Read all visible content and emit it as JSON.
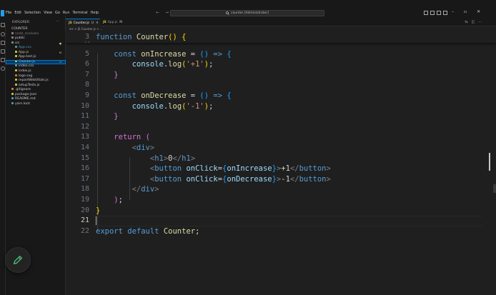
{
  "menu": [
    "File",
    "Edit",
    "Selection",
    "View",
    "Go",
    "Run",
    "Terminal",
    "Help"
  ],
  "search": {
    "text": "counter [Administrator]"
  },
  "explorer": {
    "header": "EXPLORER",
    "items": [
      {
        "label": "COUNTER",
        "depth": 0,
        "kind": "root"
      },
      {
        "label": "node_modules",
        "depth": 1,
        "kind": "folder",
        "color": "#7d7d7d"
      },
      {
        "label": "public",
        "depth": 1,
        "kind": "folder",
        "color": "#cccccc"
      },
      {
        "label": "src",
        "depth": 1,
        "kind": "folder",
        "color": "#cccccc",
        "badge": "●"
      },
      {
        "label": "App.css",
        "depth": 2,
        "kind": "css",
        "color": "#519aba"
      },
      {
        "label": "App.js",
        "depth": 2,
        "kind": "js",
        "color": "#e2c08d",
        "badge": "M"
      },
      {
        "label": "App.test.js",
        "depth": 2,
        "kind": "js",
        "color": "#cccccc"
      },
      {
        "label": "Counter.js",
        "depth": 2,
        "kind": "js",
        "color": "#cccccc",
        "badge": "U",
        "selected": true
      },
      {
        "label": "index.css",
        "depth": 2,
        "kind": "css",
        "color": "#cccccc"
      },
      {
        "label": "index.js",
        "depth": 2,
        "kind": "js",
        "color": "#cccccc"
      },
      {
        "label": "logo.svg",
        "depth": 2,
        "kind": "svg",
        "color": "#cccccc"
      },
      {
        "label": "reportWebVitals.js",
        "depth": 2,
        "kind": "js",
        "color": "#cccccc"
      },
      {
        "label": "setupTests.js",
        "depth": 2,
        "kind": "js",
        "color": "#cccccc"
      },
      {
        "label": ".gitignore",
        "depth": 1,
        "kind": "git",
        "color": "#cccccc"
      },
      {
        "label": "package.json",
        "depth": 1,
        "kind": "json",
        "color": "#cccccc"
      },
      {
        "label": "README.md",
        "depth": 1,
        "kind": "md",
        "color": "#cccccc"
      },
      {
        "label": "yarn.lock",
        "depth": 1,
        "kind": "yarn",
        "color": "#cccccc"
      }
    ]
  },
  "tabs": [
    {
      "label": "Counter.js",
      "status": "U",
      "active": true
    },
    {
      "label": "App.js",
      "status": "M",
      "active": false
    }
  ],
  "breadcrumb": "src > JS Counter.js > ...",
  "sticky_line": {
    "number": "3",
    "sub": "1-4"
  },
  "code_lines": [
    {
      "n": "5",
      "tokens": [
        [
          "    ",
          "tx"
        ],
        [
          "const ",
          "kw"
        ],
        [
          "onIncrease",
          "fn"
        ],
        [
          " = ",
          "tx"
        ],
        [
          "()",
          "p3"
        ],
        [
          " => ",
          "kw"
        ],
        [
          "{",
          "p3"
        ]
      ]
    },
    {
      "n": "6",
      "tokens": [
        [
          "        ",
          "tx"
        ],
        [
          "console",
          "var"
        ],
        [
          ".",
          "tx"
        ],
        [
          "log",
          "fn"
        ],
        [
          "(",
          "p1"
        ],
        [
          "'+1'",
          "str"
        ],
        [
          ")",
          "p1"
        ],
        [
          ";",
          "tx"
        ]
      ]
    },
    {
      "n": "7",
      "tokens": [
        [
          "    ",
          "tx"
        ],
        [
          "}",
          "p2"
        ]
      ]
    },
    {
      "n": "8",
      "tokens": []
    },
    {
      "n": "9",
      "tokens": [
        [
          "    ",
          "tx"
        ],
        [
          "const ",
          "kw"
        ],
        [
          "onDecrease",
          "fn"
        ],
        [
          " = ",
          "tx"
        ],
        [
          "()",
          "p3"
        ],
        [
          " => ",
          "kw"
        ],
        [
          "{",
          "p3"
        ]
      ]
    },
    {
      "n": "10",
      "tokens": [
        [
          "        ",
          "tx"
        ],
        [
          "console",
          "var"
        ],
        [
          ".",
          "tx"
        ],
        [
          "log",
          "fn"
        ],
        [
          "(",
          "p1"
        ],
        [
          "'-1'",
          "str"
        ],
        [
          ")",
          "p1"
        ],
        [
          ";",
          "tx"
        ]
      ]
    },
    {
      "n": "11",
      "tokens": [
        [
          "    ",
          "tx"
        ],
        [
          "}",
          "p2"
        ]
      ]
    },
    {
      "n": "12",
      "tokens": []
    },
    {
      "n": "13",
      "tokens": [
        [
          "    ",
          "tx"
        ],
        [
          "return ",
          "p2"
        ],
        [
          "(",
          "p2"
        ]
      ]
    },
    {
      "n": "14",
      "tokens": [
        [
          "        ",
          "tx"
        ],
        [
          "<",
          "ang"
        ],
        [
          "div",
          "tag"
        ],
        [
          ">",
          "ang"
        ]
      ]
    },
    {
      "n": "15",
      "tokens": [
        [
          "            ",
          "tx"
        ],
        [
          "<",
          "ang"
        ],
        [
          "h1",
          "tag"
        ],
        [
          ">",
          "ang"
        ],
        [
          "0",
          "tx"
        ],
        [
          "</",
          "ang"
        ],
        [
          "h1",
          "tag"
        ],
        [
          ">",
          "ang"
        ]
      ]
    },
    {
      "n": "16",
      "tokens": [
        [
          "            ",
          "tx"
        ],
        [
          "<",
          "ang"
        ],
        [
          "button",
          "tag"
        ],
        [
          " ",
          "tx"
        ],
        [
          "onClick",
          "var"
        ],
        [
          "=",
          "tx"
        ],
        [
          "{",
          "p3"
        ],
        [
          "onIncrease",
          "var"
        ],
        [
          "}",
          "p3"
        ],
        [
          ">",
          "ang"
        ],
        [
          "+1",
          "tx"
        ],
        [
          "</",
          "ang"
        ],
        [
          "button",
          "tag"
        ],
        [
          ">",
          "ang"
        ]
      ]
    },
    {
      "n": "17",
      "tokens": [
        [
          "            ",
          "tx"
        ],
        [
          "<",
          "ang"
        ],
        [
          "button",
          "tag"
        ],
        [
          " ",
          "tx"
        ],
        [
          "onClick",
          "var"
        ],
        [
          "=",
          "tx"
        ],
        [
          "{",
          "p3"
        ],
        [
          "onDecrease",
          "var"
        ],
        [
          "}",
          "p3"
        ],
        [
          ">",
          "ang"
        ],
        [
          "-1",
          "tx"
        ],
        [
          "</",
          "ang"
        ],
        [
          "button",
          "tag"
        ],
        [
          ">",
          "ang"
        ]
      ]
    },
    {
      "n": "18",
      "tokens": [
        [
          "        ",
          "tx"
        ],
        [
          "</",
          "ang"
        ],
        [
          "div",
          "tag"
        ],
        [
          ">",
          "ang"
        ]
      ]
    },
    {
      "n": "19",
      "tokens": [
        [
          "    ",
          "tx"
        ],
        [
          ")",
          "p2"
        ],
        [
          ";",
          "tx"
        ]
      ]
    },
    {
      "n": "20",
      "tokens": [
        [
          "}",
          "p1"
        ]
      ]
    },
    {
      "n": "21",
      "tokens": [],
      "current": true
    },
    {
      "n": "22",
      "tokens": [
        [
          "export ",
          "kw"
        ],
        [
          "default ",
          "kw"
        ],
        [
          "Counter",
          "fn"
        ],
        [
          ";",
          "tx"
        ]
      ]
    }
  ],
  "colors": {
    "accent": "#0078d4",
    "keyword": "#569cd6",
    "function": "#dcdcaa",
    "variable": "#9cdcfe",
    "string": "#ce9178",
    "bracket1": "#ffd700",
    "bracket2": "#da70d6",
    "bracket3": "#179fff",
    "fab_icon": "#4ec27a"
  }
}
